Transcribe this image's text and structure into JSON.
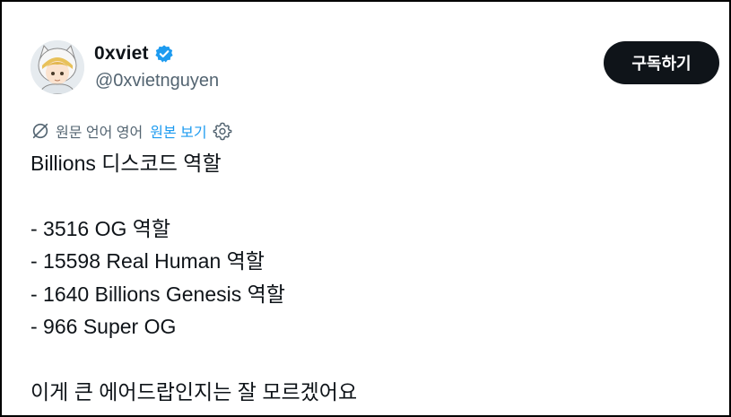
{
  "author": {
    "display_name": "0xviet",
    "handle": "@0xvietnguyen",
    "verified_badge_icon": "verified-badge-icon",
    "avatar_icon": "anime-character-avatar"
  },
  "actions": {
    "subscribe_label": "구독하기"
  },
  "translation": {
    "icon": "translate-icon",
    "original_language_label": "원문 언어 영어",
    "show_original_label": "원본 보기",
    "settings_icon": "gear-icon"
  },
  "tweet": {
    "lines": [
      "Billions 디스코드 역할",
      "",
      "- 3516 OG 역할",
      "- 15598 Real Human 역할",
      "- 1640 Billions Genesis 역할",
      "- 966 Super OG",
      "",
      "이게 큰 에어드랍인지는 잘 모르겠어요"
    ]
  },
  "colors": {
    "text_primary": "#0f1419",
    "text_secondary": "#536471",
    "link_blue": "#1d9bf0",
    "verified_blue": "#1d9bf0",
    "button_bg": "#0f1419",
    "button_text": "#ffffff",
    "frame_border": "#000000"
  }
}
